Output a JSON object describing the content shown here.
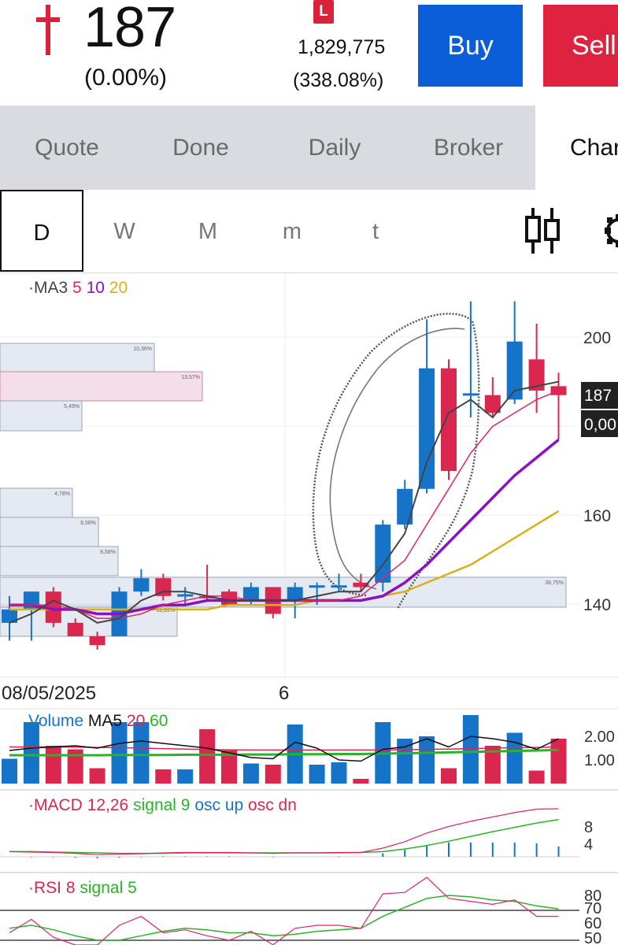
{
  "quote": {
    "last_price": "187",
    "change_pct": "(0.00%)",
    "lot_badge": "L",
    "volume_total": "1,829,775",
    "volume_pct": "(338.08%)"
  },
  "actions": {
    "buy_label": "Buy",
    "sell_label": "Sell"
  },
  "tabs": [
    "Quote",
    "Done",
    "Daily",
    "Broker",
    "Chart"
  ],
  "active_tab": "Chart",
  "periods": [
    "D",
    "W",
    "M",
    "m",
    "t"
  ],
  "active_period": "D",
  "icons": {
    "price_mark": "cross-icon",
    "chart_style": "candlestick-icon",
    "settings": "gear-icon"
  },
  "colors": {
    "up": "#1674c8",
    "down": "#d92750",
    "ma5": "#e0246a",
    "ma10": "#8a12c2",
    "ma20": "#d6b219",
    "accent_buy": "#0b5ed7",
    "accent_sell": "#df2240",
    "signal_green": "#29b329"
  },
  "chart_data": {
    "type": "candlestick",
    "price_legend": {
      "prefix": "MA3",
      "ma5": "5",
      "ma10": "10",
      "ma20": "20"
    },
    "y_ticks": [
      "200",
      "160",
      "140"
    ],
    "price_tag": "187",
    "change_tag": "0,00",
    "x_labels": [
      "08/05/2025",
      "6"
    ],
    "volume_profile": [
      "10,36%",
      "13,57%",
      "5,49%",
      "4,78%",
      "6,58%",
      "8,58%",
      "11,90%",
      "38,75%"
    ],
    "candles": [
      {
        "o": 136,
        "h": 142,
        "l": 132,
        "c": 139,
        "dir": "up"
      },
      {
        "o": 139,
        "h": 143,
        "l": 132,
        "c": 143,
        "dir": "up"
      },
      {
        "o": 143,
        "h": 144,
        "l": 135,
        "c": 136,
        "dir": "down"
      },
      {
        "o": 136,
        "h": 137,
        "l": 133,
        "c": 133,
        "dir": "down"
      },
      {
        "o": 133,
        "h": 134,
        "l": 130,
        "c": 131,
        "dir": "down"
      },
      {
        "o": 133,
        "h": 144,
        "l": 133,
        "c": 143,
        "dir": "up"
      },
      {
        "o": 143,
        "h": 148,
        "l": 142,
        "c": 146,
        "dir": "up"
      },
      {
        "o": 146,
        "h": 147,
        "l": 141,
        "c": 142,
        "dir": "down"
      },
      {
        "o": 142,
        "h": 144,
        "l": 140,
        "c": 142.4,
        "dir": "up"
      },
      {
        "o": 142,
        "h": 149,
        "l": 141,
        "c": 142,
        "dir": "down"
      },
      {
        "o": 143,
        "h": 143.5,
        "l": 140,
        "c": 140,
        "dir": "down"
      },
      {
        "o": 141,
        "h": 145,
        "l": 140,
        "c": 144,
        "dir": "up"
      },
      {
        "o": 144,
        "h": 144,
        "l": 137,
        "c": 138,
        "dir": "down"
      },
      {
        "o": 141,
        "h": 145,
        "l": 137,
        "c": 144,
        "dir": "up"
      },
      {
        "o": 144,
        "h": 145,
        "l": 140,
        "c": 144.4,
        "dir": "up"
      },
      {
        "o": 144,
        "h": 147,
        "l": 143,
        "c": 144.4,
        "dir": "up"
      },
      {
        "o": 145,
        "h": 147,
        "l": 143,
        "c": 144,
        "dir": "down"
      },
      {
        "o": 145,
        "h": 159,
        "l": 143,
        "c": 158,
        "dir": "up"
      },
      {
        "o": 158,
        "h": 168,
        "l": 157,
        "c": 166,
        "dir": "up"
      },
      {
        "o": 166,
        "h": 204,
        "l": 165,
        "c": 193,
        "dir": "up"
      },
      {
        "o": 193,
        "h": 195,
        "l": 168,
        "c": 170,
        "dir": "down"
      },
      {
        "o": 187,
        "h": 208,
        "l": 182,
        "c": 187.4,
        "dir": "up"
      },
      {
        "o": 187,
        "h": 191,
        "l": 182,
        "c": 183,
        "dir": "down"
      },
      {
        "o": 186,
        "h": 208,
        "l": 185,
        "c": 199,
        "dir": "up"
      },
      {
        "o": 195,
        "h": 203,
        "l": 183,
        "c": 188,
        "dir": "down"
      },
      {
        "o": 189,
        "h": 192,
        "l": 177,
        "c": 187,
        "dir": "down"
      }
    ],
    "ma_close": [
      136,
      138,
      141,
      139,
      136,
      137,
      141,
      143,
      143,
      142,
      141,
      141,
      141,
      141,
      142,
      143,
      143,
      149,
      156,
      172,
      183,
      186,
      182,
      188,
      189,
      190
    ],
    "ma5": [
      140,
      140,
      140,
      139,
      137,
      137,
      138,
      140,
      141,
      142,
      142,
      141,
      141,
      141,
      141,
      141,
      142,
      146,
      150,
      158,
      166,
      174,
      180,
      183,
      186,
      188
    ],
    "ma10": [
      140,
      140,
      139,
      139,
      138,
      138,
      139,
      140,
      140,
      141,
      141,
      141,
      141,
      141,
      141,
      141,
      141,
      142,
      145,
      149,
      154,
      159,
      164,
      169,
      173,
      177
    ],
    "ma20": [
      139,
      139,
      139,
      139,
      139,
      139,
      139,
      139,
      139,
      139,
      140,
      140,
      140,
      140,
      141,
      141,
      141,
      142,
      143,
      145,
      147,
      149,
      152,
      155,
      158,
      161
    ],
    "volume": {
      "legend": {
        "name": "Volume",
        "ma5": "MA5",
        "ma20": "20",
        "ma60": "60"
      },
      "ticks": [
        "2.00",
        "1.00"
      ],
      "values": [
        1.05,
        2.6,
        1.6,
        1.45,
        0.65,
        2.6,
        2.6,
        0.6,
        0.6,
        2.3,
        1.4,
        0.85,
        0.8,
        2.5,
        0.8,
        0.9,
        0.2,
        2.6,
        1.9,
        2.0,
        0.65,
        2.9,
        1.6,
        2.15,
        0.55,
        1.9
      ],
      "ma5": [
        1.4,
        1.5,
        1.55,
        1.6,
        1.5,
        1.7,
        1.8,
        1.7,
        1.6,
        1.5,
        1.3,
        1.1,
        1.05,
        1.75,
        1.5,
        1.0,
        0.95,
        1.45,
        1.55,
        1.9,
        1.55,
        2.0,
        1.9,
        1.75,
        1.45,
        1.9
      ],
      "ma20": [
        1.55,
        1.55,
        1.55,
        1.54,
        1.53,
        1.52,
        1.5,
        1.48,
        1.46,
        1.44,
        1.43,
        1.42,
        1.42,
        1.42,
        1.42,
        1.42,
        1.42,
        1.42,
        1.43,
        1.45,
        1.46,
        1.48,
        1.5,
        1.52,
        1.53,
        1.55
      ],
      "ma60": [
        1.2,
        1.2,
        1.2,
        1.2,
        1.2,
        1.21,
        1.21,
        1.21,
        1.22,
        1.22,
        1.22,
        1.23,
        1.23,
        1.24,
        1.24,
        1.25,
        1.25,
        1.27,
        1.28,
        1.3,
        1.32,
        1.34,
        1.36,
        1.38,
        1.4,
        1.42
      ]
    },
    "macd": {
      "legend": {
        "name": "MACD",
        "params": "12,26",
        "signal": "signal 9",
        "osc_up": "osc up",
        "osc_dn": "osc dn"
      },
      "ticks": [
        "8",
        "4"
      ],
      "macd": [
        1.2,
        1.1,
        1.0,
        0.8,
        0.5,
        0.6,
        0.7,
        0.9,
        1.0,
        1.0,
        1.0,
        0.9,
        0.8,
        0.9,
        0.9,
        1.0,
        1.0,
        2.0,
        3.5,
        5.5,
        7.0,
        8.2,
        9.2,
        10.2,
        11.0,
        11.1
      ],
      "signal": [
        1.2,
        1.2,
        1.1,
        1.0,
        0.9,
        0.8,
        0.8,
        0.8,
        0.9,
        0.9,
        0.9,
        0.9,
        0.9,
        0.9,
        0.9,
        0.9,
        1.0,
        1.2,
        1.8,
        2.6,
        3.6,
        4.7,
        5.8,
        6.8,
        7.8,
        8.6
      ],
      "osc": [
        0,
        -0.1,
        -0.1,
        -0.2,
        -0.3,
        -0.2,
        -0.1,
        0.1,
        0.1,
        0.1,
        0.1,
        0,
        -0.1,
        0,
        0,
        0.1,
        0,
        0.8,
        1.6,
        2.7,
        3.3,
        3.3,
        3.3,
        3.3,
        3.1,
        2.4
      ]
    },
    "rsi": {
      "legend": {
        "name": "RSI",
        "period": "8",
        "signal": "signal 5"
      },
      "ticks": [
        "80",
        "70",
        "60",
        "50"
      ],
      "rsi": [
        55,
        64,
        52,
        44,
        40,
        60,
        66,
        55,
        57,
        53,
        50,
        56,
        47,
        58,
        60,
        60,
        58,
        81,
        82,
        92,
        78,
        76,
        74,
        77,
        66,
        66
      ],
      "signal": [
        58,
        60,
        57,
        53,
        50,
        50,
        53,
        56,
        58,
        57,
        55,
        55,
        53,
        54,
        56,
        57,
        58,
        66,
        72,
        78,
        80,
        79,
        77,
        76,
        73,
        71
      ]
    }
  }
}
